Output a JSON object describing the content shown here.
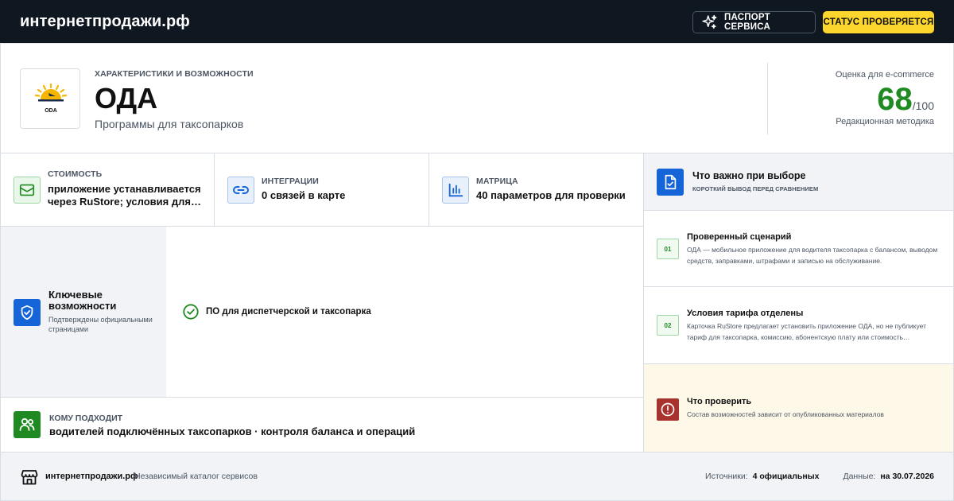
{
  "header": {
    "brand": "интернетпродажи.рф",
    "passport_label": "ПАСПОРТ СЕРВИСА",
    "status_label": "СТАТУС ПРОВЕРЯЕТСЯ",
    "passport_icon": "sparkle-icon"
  },
  "hero": {
    "logo_caption": "ODA",
    "kicker": "ХАРАКТЕРИСТИКИ И ВОЗМОЖНОСТИ",
    "title": "ОДА",
    "subtitle": "Программы для таксопарков",
    "score_label": "Оценка для e-commerce",
    "score": "68",
    "score_max": "/100",
    "score_note": "Редакционная методика",
    "score_color": "#1f8a22"
  },
  "stats": [
    {
      "label": "СТОИМОСТЬ",
      "value": "приложение устанавливается через RuStore; условия для…",
      "icon": "wallet-icon"
    },
    {
      "label": "ИНТЕГРАЦИИ",
      "value": "0 связей в карте",
      "icon": "link-icon"
    },
    {
      "label": "МАТРИЦА",
      "value": "40 параметров для проверки",
      "icon": "bar-chart-icon"
    }
  ],
  "capabilities": {
    "title": "Ключевые возможности",
    "note": "Подтверждены официальными страницами",
    "items": [
      "ПО для диспетчерской и таксопарка"
    ]
  },
  "audience": {
    "label": "КОМУ ПОДХОДИТ",
    "value": "водителей подключённых таксопарков · контроля баланса и операций"
  },
  "right_panel": {
    "title": "Что важно при выборе",
    "subtitle": "КОРОТКИЙ ВЫВОД ПЕРЕД СРАВНЕНИЕМ",
    "cards": [
      {
        "num": "01",
        "title": "Проверенный сценарий",
        "text": "ОДА — мобильное приложение для водителя таксопарка с балансом, выводом средств, заправками, штрафами и записью на обслуживание."
      },
      {
        "num": "02",
        "title": "Условия тарифа отделены",
        "text": "Карточка RuStore предлагает установить приложение ОДА, но не публикует тариф для таксопарка, комиссию, абонентскую плату или стоимость…"
      }
    ],
    "warning": {
      "title": "Что проверить",
      "text": "Состав возможностей зависит от опубликованных материалов"
    }
  },
  "footer": {
    "brand": "интернетпродажи.рф",
    "tagline": "Независимый каталог сервисов",
    "sources_label": "Источники:",
    "sources_value": "4 официальных",
    "data_label": "Данные:",
    "data_value": "на 30.07.2026"
  },
  "colors": {
    "header_bg": "#0f1720",
    "status_yellow": "#fcd62c",
    "accent_blue": "#1565d8",
    "accent_green": "#1f8a22",
    "warning_red": "#a8322d"
  }
}
